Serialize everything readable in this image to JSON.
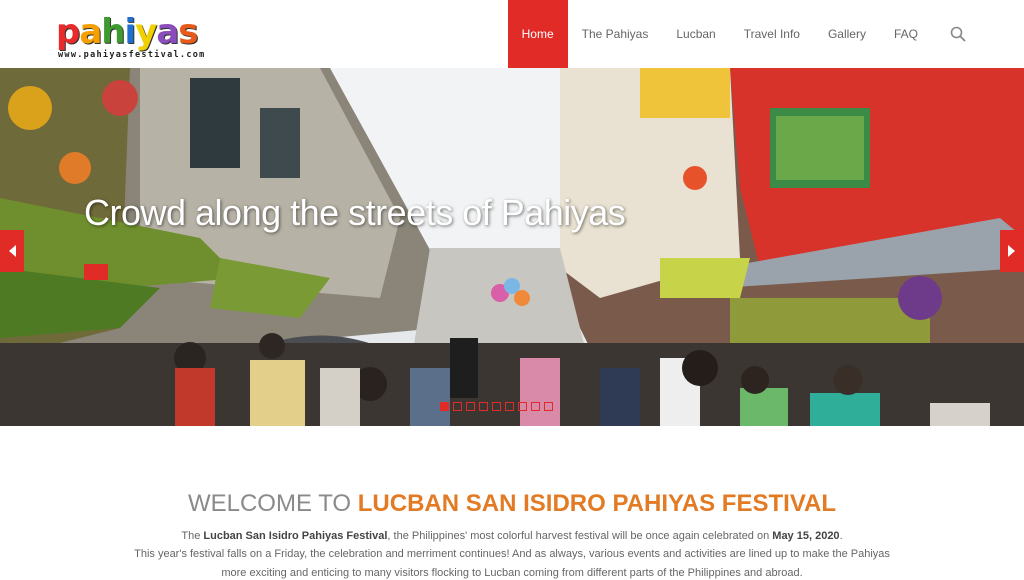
{
  "header": {
    "logo": {
      "word_letters": [
        "p",
        "a",
        "h",
        "i",
        "y",
        "a",
        "s"
      ],
      "word_colors": [
        "#e82a2a",
        "#f5a000",
        "#3d9a2e",
        "#1f6fd1",
        "#f0d000",
        "#8a4dbb",
        "#e85a1a"
      ],
      "url": "www.pahiyasfestival.com"
    },
    "nav": {
      "items": [
        "Home",
        "The Pahiyas",
        "Lucban",
        "Travel Info",
        "Gallery",
        "FAQ"
      ],
      "active_index": 0
    },
    "search_icon": "search-icon"
  },
  "hero": {
    "caption": "Crowd along the streets of Pahiyas",
    "prev_icon": "chevron-left-icon",
    "next_icon": "chevron-right-icon",
    "slide_count": 9,
    "active_slide": 1
  },
  "welcome": {
    "title_gray": "WELCOME TO ",
    "title_orange": "LUCBAN SAN ISIDRO PAHIYAS FESTIVAL",
    "p1_a": "The ",
    "p1_bold1": "Lucban San Isidro Pahiyas Festival",
    "p1_b": ", the Philippines' most colorful harvest festival will be once again celebrated on ",
    "p1_bold2": "May 15, 2020",
    "p1_c": ".",
    "p2": "This year's festival falls on a Friday, the celebration and merriment continues! And as always, various events and activities are lined up to make the Pahiyas",
    "p3": "more exciting and enticing to many visitors flocking to Lucban coming from different parts of the Philippines and abroad."
  },
  "colors": {
    "accent": "#e02b27",
    "title_orange": "#e27b24",
    "title_gray": "#8a8a8a"
  }
}
